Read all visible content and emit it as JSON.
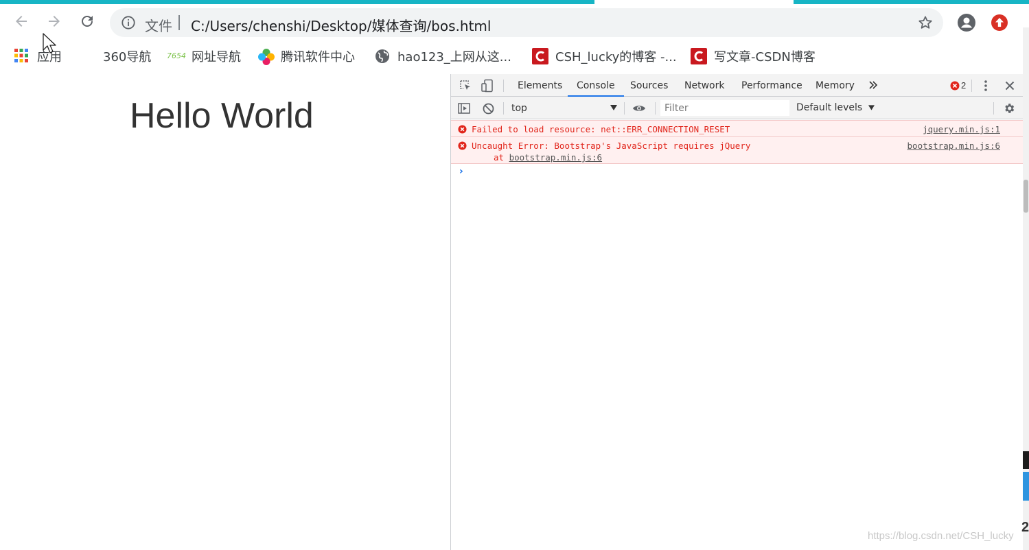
{
  "browser": {
    "omnibox": {
      "security_label": "文件",
      "url": "C:/Users/chenshi/Desktop/媒体查询/bos.html"
    },
    "bookmarks": [
      {
        "label": "应用",
        "icon": "apps-grid-icon"
      },
      {
        "label": "360导航",
        "icon": "blank-favicon"
      },
      {
        "label": "网址导航",
        "icon": "7654-favicon",
        "icon_text": "7654"
      },
      {
        "label": "腾讯软件中心",
        "icon": "tencent-software-icon"
      },
      {
        "label": "hao123_上网从这...",
        "icon": "globe-icon"
      },
      {
        "label": "CSH_lucky的博客 -...",
        "icon": "csdn-icon"
      },
      {
        "label": "写文章-CSDN博客",
        "icon": "csdn-icon"
      }
    ]
  },
  "page": {
    "heading": "Hello World"
  },
  "devtools": {
    "tabs": [
      "Elements",
      "Console",
      "Sources",
      "Network",
      "Performance",
      "Memory"
    ],
    "active_tab": "Console",
    "error_count": "2",
    "context": "top",
    "filter_placeholder": "Filter",
    "levels": "Default levels",
    "messages": [
      {
        "text": "Failed to load resource: net::ERR_CONNECTION_RESET",
        "source": "jquery.min.js:1"
      },
      {
        "text": "Uncaught Error: Bootstrap's JavaScript requires jQuery",
        "source": "bootstrap.min.js:6",
        "sub_prefix": "at ",
        "sub_link": "bootstrap.min.js:6"
      }
    ],
    "prompt": "›"
  },
  "watermark": "https://blog.csdn.net/CSH_lucky",
  "edge_text": "2",
  "colors": {
    "accent": "#1a73e8",
    "error": "#e1251b",
    "error_bg": "#fff0f0",
    "tab_strip": "#17b5c5",
    "update_badge": "#d93025"
  }
}
